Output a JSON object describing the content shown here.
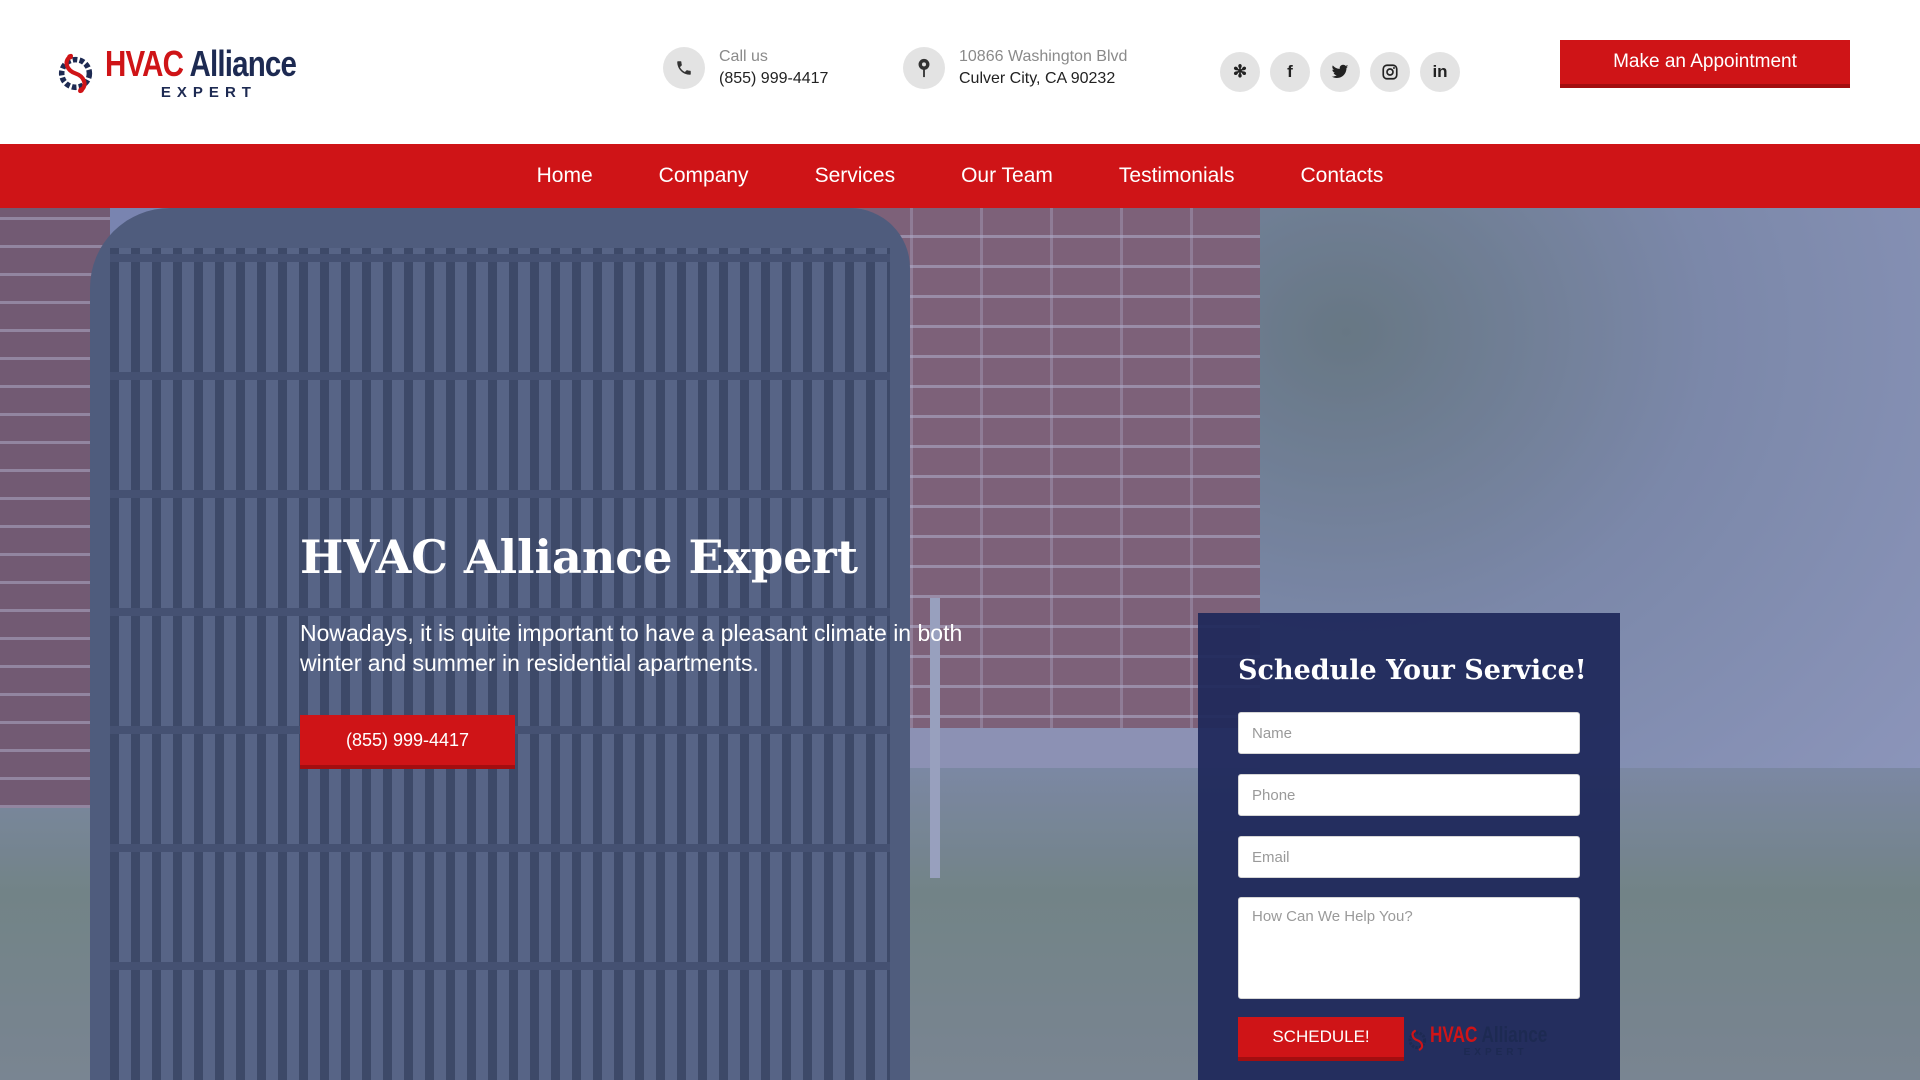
{
  "brand": {
    "name_part1": "HVAC",
    "name_part2": "Alliance",
    "tagline": "EXPERT",
    "red": "#cf1417",
    "navy": "#1d2a52"
  },
  "header": {
    "phone_label": "Call us",
    "phone_number": "(855) 999-4417",
    "address_line1": "10866 Washington Blvd",
    "address_line2": "Culver City, CA 90232",
    "socials": [
      {
        "name": "yelp-icon",
        "glyph": "✻"
      },
      {
        "name": "facebook-icon",
        "glyph": "f"
      },
      {
        "name": "twitter-icon",
        "glyph": "🐦"
      },
      {
        "name": "instagram-icon",
        "glyph": "◎"
      },
      {
        "name": "linkedin-icon",
        "glyph": "in"
      }
    ],
    "appointment_label": "Make an Appointment"
  },
  "nav": {
    "items": [
      "Home",
      "Company",
      "Services",
      "Our Team",
      "Testimonials",
      "Contacts"
    ]
  },
  "hero": {
    "title": "HVAC Alliance Expert",
    "text": "Nowadays, it is quite important to have a pleasant climate in both winter and summer in residential apartments.",
    "phone_button": "(855) 999-4417"
  },
  "form": {
    "title": "Schedule Your Service!",
    "name_placeholder": "Name",
    "phone_placeholder": "Phone",
    "email_placeholder": "Email",
    "message_placeholder": "How Can We Help You?",
    "submit_label": "SCHEDULE!"
  }
}
